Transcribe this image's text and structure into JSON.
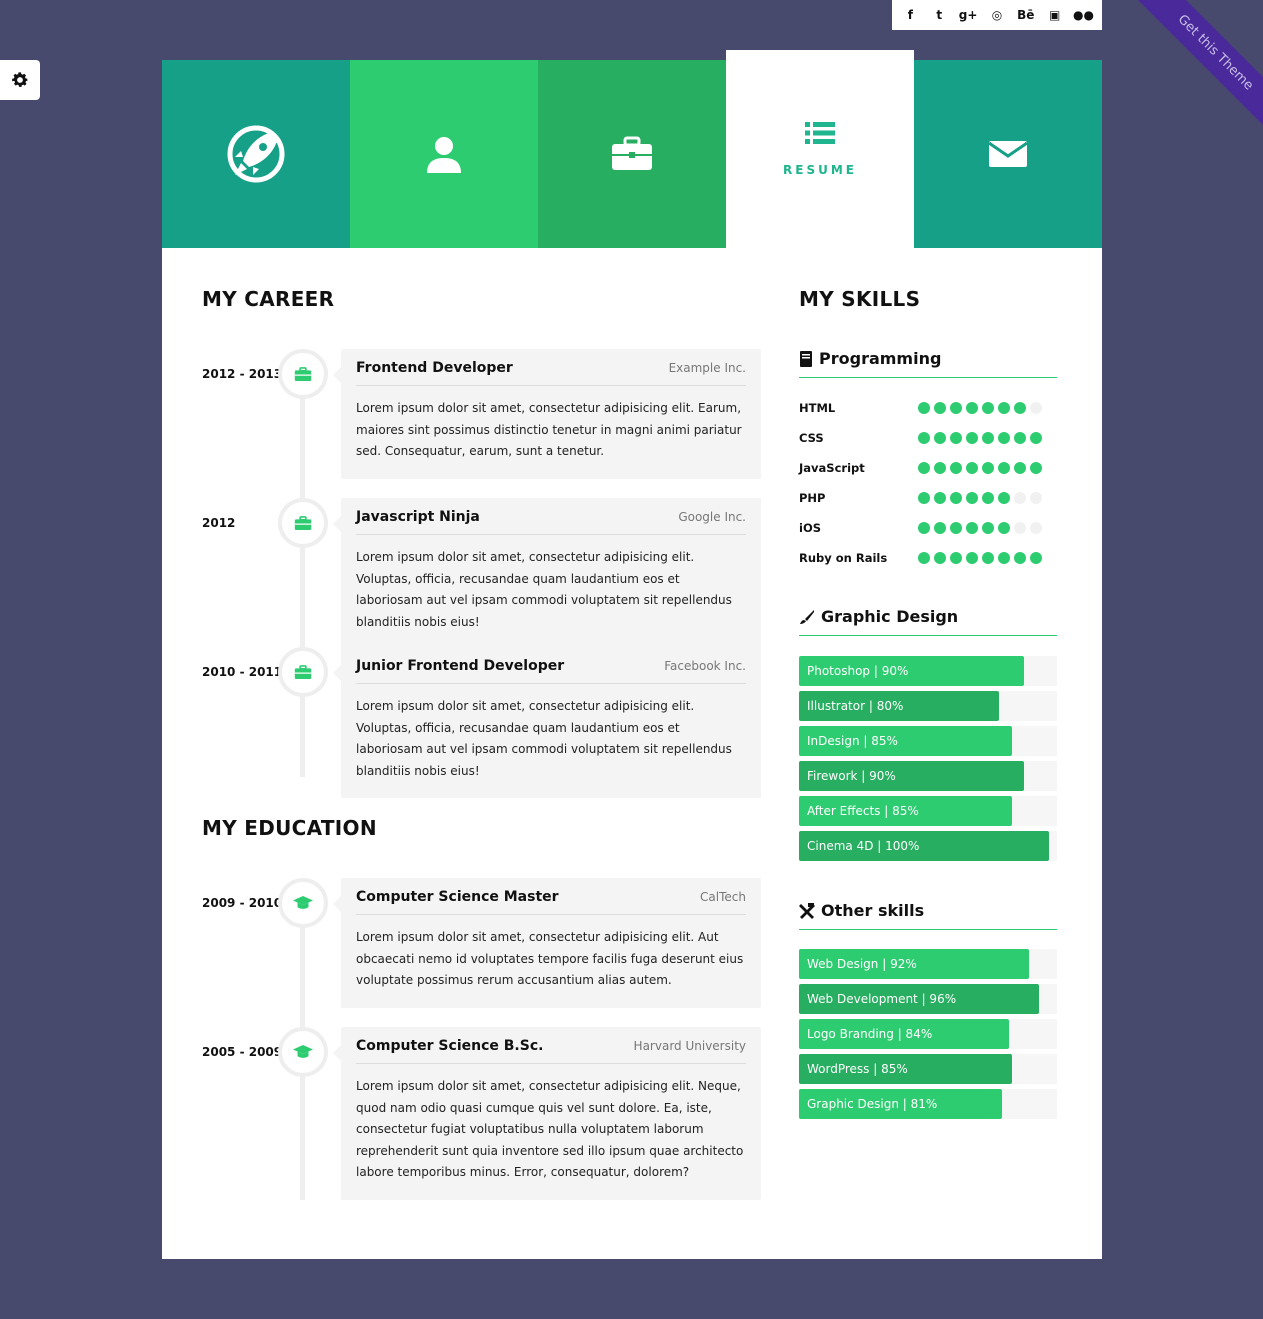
{
  "social": {
    "items": [
      {
        "icon": "facebook-icon",
        "glyph": "f"
      },
      {
        "icon": "twitter-icon",
        "glyph": "t"
      },
      {
        "icon": "google-plus-icon",
        "glyph": "g+"
      },
      {
        "icon": "dribbble-icon",
        "glyph": "◎"
      },
      {
        "icon": "behance-icon",
        "glyph": "Bē"
      },
      {
        "icon": "instagram-icon",
        "glyph": "▣"
      },
      {
        "icon": "flickr-icon",
        "glyph": "●●"
      }
    ]
  },
  "ribbon": {
    "label": "Get this Theme"
  },
  "tabs": {
    "active_label": "RESUME"
  },
  "career": {
    "title": "MY CAREER",
    "items": [
      {
        "date": "2012 - 2013",
        "role": "Frontend Developer",
        "org": "Example Inc.",
        "desc": "Lorem ipsum dolor sit amet, consectetur adipisicing elit. Earum, maiores sint possimus distinctio tenetur in magni animi pariatur sed. Consequatur, earum, sunt a tenetur."
      },
      {
        "date": "2012",
        "role": "Javascript Ninja",
        "org": "Google Inc.",
        "desc": "Lorem ipsum dolor sit amet, consectetur adipisicing elit. Voluptas, officia, recusandae quam laudantium eos et laboriosam aut vel ipsam commodi voluptatem sit repellendus blanditiis nobis eius!"
      },
      {
        "date": "2010 - 2011",
        "role": "Junior Frontend Developer",
        "org": "Facebook Inc.",
        "desc": "Lorem ipsum dolor sit amet, consectetur adipisicing elit. Voluptas, officia, recusandae quam laudantium eos et laboriosam aut vel ipsam commodi voluptatem sit repellendus blanditiis nobis eius!"
      }
    ]
  },
  "education": {
    "title": "MY EDUCATION",
    "items": [
      {
        "date": "2009 - 2010",
        "role": "Computer Science Master",
        "org": "CalTech",
        "desc": "Lorem ipsum dolor sit amet, consectetur adipisicing elit. Aut obcaecati nemo id voluptates tempore facilis fuga deserunt eius voluptate possimus rerum accusantium alias autem."
      },
      {
        "date": "2005 - 2009",
        "role": "Computer Science B.Sc.",
        "org": "Harvard University",
        "desc": "Lorem ipsum dolor sit amet, consectetur adipisicing elit. Neque, quod nam odio quasi cumque quis vel sunt dolore. Ea, iste, consectetur fugiat voluptatibus nulla voluptatem laborum reprehenderit sunt quia inventore sed illo ipsum quae architecto labore temporibus minus. Error, consequatur, dolorem?"
      }
    ]
  },
  "skills": {
    "title": "MY SKILLS",
    "programming": {
      "title": "Programming",
      "max": 8,
      "items": [
        {
          "name": "HTML",
          "level": 7
        },
        {
          "name": "CSS",
          "level": 8
        },
        {
          "name": "JavaScript",
          "level": 8
        },
        {
          "name": "PHP",
          "level": 6
        },
        {
          "name": "iOS",
          "level": 6
        },
        {
          "name": "Ruby on Rails",
          "level": 8
        }
      ]
    },
    "graphic": {
      "title": "Graphic Design",
      "items": [
        {
          "label": "Photoshop | 90%",
          "percent": 90
        },
        {
          "label": "Illustrator | 80%",
          "percent": 80
        },
        {
          "label": "InDesign | 85%",
          "percent": 85
        },
        {
          "label": "Firework | 90%",
          "percent": 90
        },
        {
          "label": "After Effects | 85%",
          "percent": 85
        },
        {
          "label": "Cinema 4D | 100%",
          "percent": 100
        }
      ]
    },
    "other": {
      "title": "Other skills",
      "items": [
        {
          "label": "Web Design | 92%",
          "percent": 92
        },
        {
          "label": "Web Development | 96%",
          "percent": 96
        },
        {
          "label": "Logo Branding | 84%",
          "percent": 84
        },
        {
          "label": "WordPress | 85%",
          "percent": 85
        },
        {
          "label": "Graphic Design | 81%",
          "percent": 81
        }
      ]
    }
  },
  "colors": {
    "background": "#484a6d",
    "teal": "#17a088",
    "green": "#2ecc71",
    "dark_green": "#27ae60",
    "ribbon": "#4a2a9a"
  }
}
